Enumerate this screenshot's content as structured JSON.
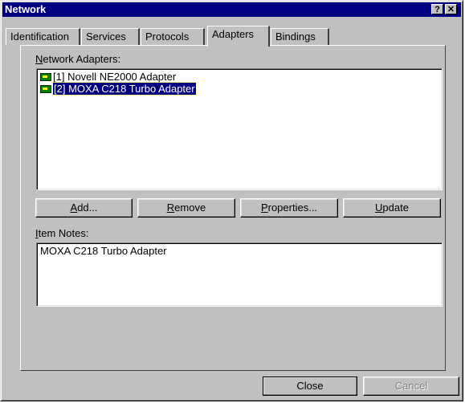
{
  "window": {
    "title": "Network",
    "help_button": "?",
    "close_button": "✕"
  },
  "tabs": [
    {
      "label": "Identification"
    },
    {
      "label": "Services"
    },
    {
      "label": "Protocols"
    },
    {
      "label": "Adapters",
      "active": true
    },
    {
      "label": "Bindings"
    }
  ],
  "adapters": {
    "label_access_key": "N",
    "label_rest": "etwork Adapters:",
    "items": [
      {
        "text": "[1] Novell NE2000 Adapter",
        "icon": "network-card-icon",
        "selected": false
      },
      {
        "text": "[2] MOXA C218 Turbo Adapter",
        "icon": "network-card-icon",
        "selected": true
      }
    ]
  },
  "buttons": {
    "add": {
      "key": "A",
      "rest": "dd..."
    },
    "remove": {
      "key": "R",
      "rest": "emove"
    },
    "properties": {
      "key": "P",
      "rest": "roperties..."
    },
    "update": {
      "key": "U",
      "rest": "pdate"
    }
  },
  "notes": {
    "label_access_key": "I",
    "label_rest": "tem Notes:",
    "text": "MOXA C218 Turbo Adapter"
  },
  "footer": {
    "close": "Close",
    "cancel": "Cancel"
  }
}
